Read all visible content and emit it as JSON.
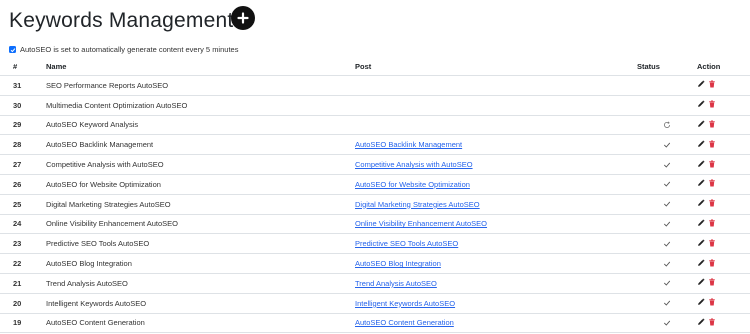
{
  "header": {
    "title": "Keywords Management"
  },
  "autoseo": {
    "checked": true,
    "label": "AutoSEO is set to automatically generate content every 5 minutes"
  },
  "table": {
    "columns": [
      "#",
      "Name",
      "Post",
      "Status",
      "Action"
    ],
    "rows": [
      {
        "num": "31",
        "name": "SEO Performance Reports AutoSEO",
        "post": "",
        "status": ""
      },
      {
        "num": "30",
        "name": "Multimedia Content Optimization AutoSEO",
        "post": "",
        "status": ""
      },
      {
        "num": "29",
        "name": "AutoSEO Keyword Analysis",
        "post": "",
        "status": "refresh-icon"
      },
      {
        "num": "28",
        "name": "AutoSEO Backlink Management",
        "post": "AutoSEO Backlink Management",
        "status": "check-icon"
      },
      {
        "num": "27",
        "name": "Competitive Analysis with AutoSEO",
        "post": "Competitive Analysis with AutoSEO",
        "status": "check-icon"
      },
      {
        "num": "26",
        "name": "AutoSEO for Website Optimization",
        "post": "AutoSEO for Website Optimization",
        "status": "check-icon"
      },
      {
        "num": "25",
        "name": "Digital Marketing Strategies AutoSEO",
        "post": "Digital Marketing Strategies AutoSEO",
        "status": "check-icon"
      },
      {
        "num": "24",
        "name": "Online Visibility Enhancement AutoSEO",
        "post": "Online Visibility Enhancement AutoSEO",
        "status": "check-icon"
      },
      {
        "num": "23",
        "name": "Predictive SEO Tools AutoSEO",
        "post": "Predictive SEO Tools AutoSEO",
        "status": "check-icon"
      },
      {
        "num": "22",
        "name": "AutoSEO Blog Integration",
        "post": "AutoSEO Blog Integration",
        "status": "check-icon"
      },
      {
        "num": "21",
        "name": "Trend Analysis AutoSEO",
        "post": "Trend Analysis AutoSEO",
        "status": "check-icon"
      },
      {
        "num": "20",
        "name": "Intelligent Keywords AutoSEO",
        "post": "Intelligent Keywords AutoSEO",
        "status": "check-icon"
      },
      {
        "num": "19",
        "name": "AutoSEO Content Generation",
        "post": "AutoSEO Content Generation",
        "status": "check-icon"
      }
    ]
  },
  "colors": {
    "link": "#2563eb",
    "delete": "#dc3545",
    "checkbox": "#0d6efd"
  },
  "icons": {
    "add": "plus-circle-icon",
    "edit": "pencil-icon",
    "delete": "trash-icon"
  }
}
